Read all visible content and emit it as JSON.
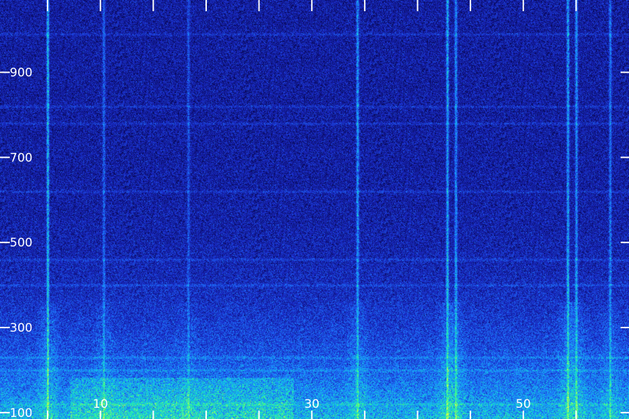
{
  "chart_data": {
    "type": "heatmap",
    "title": "",
    "xlabel": "",
    "ylabel": "",
    "x_range": [
      0.5,
      60
    ],
    "y_range": [
      85,
      1070
    ],
    "x_ticks": [
      0,
      5,
      10,
      15,
      20,
      25,
      30,
      35,
      40,
      45,
      50,
      55
    ],
    "x_tick_labels": [
      {
        "value": 10,
        "label": "10"
      },
      {
        "value": 30,
        "label": "30"
      },
      {
        "value": 50,
        "label": "50"
      }
    ],
    "y_ticks": [
      {
        "value": 100,
        "label": "100"
      },
      {
        "value": 300,
        "label": "300"
      },
      {
        "value": 500,
        "label": "500"
      },
      {
        "value": 700,
        "label": "700"
      },
      {
        "value": 900,
        "label": "900"
      }
    ],
    "colormap": [
      "#000000",
      "#0a0a60",
      "#1a2ac8",
      "#1e7aff",
      "#10d0e0",
      "#40ff80",
      "#f0ff40"
    ],
    "background_color": "#0d0d78",
    "vertical_bursts": [
      {
        "x": 5.0,
        "intensity": 0.95
      },
      {
        "x": 10.3,
        "intensity": 0.5
      },
      {
        "x": 18.3,
        "intensity": 0.4
      },
      {
        "x": 34.3,
        "intensity": 0.75
      },
      {
        "x": 42.8,
        "intensity": 0.9
      },
      {
        "x": 43.6,
        "intensity": 0.7
      },
      {
        "x": 54.2,
        "intensity": 0.85
      },
      {
        "x": 55.0,
        "intensity": 0.75
      },
      {
        "x": 58.2,
        "intensity": 0.6
      }
    ],
    "horizontal_bands": [
      120,
      200,
      230,
      400,
      460,
      620,
      780,
      820,
      990
    ]
  }
}
